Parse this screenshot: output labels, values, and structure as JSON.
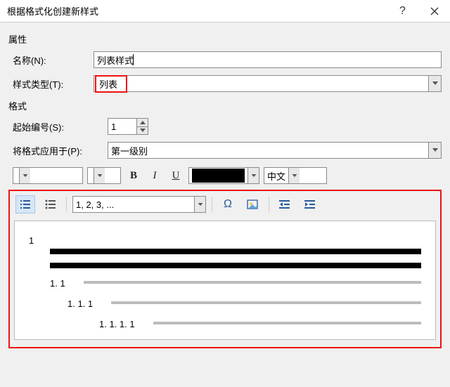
{
  "title": "根据格式化创建新样式",
  "sections": {
    "properties": "属性",
    "format": "格式"
  },
  "labels": {
    "name": "名称(N):",
    "styleType": "样式类型(T):",
    "startNumber": "起始编号(S):",
    "applyTo": "将格式应用于(P):"
  },
  "values": {
    "name": "列表样式",
    "styleType": "列表",
    "startNumber": "1",
    "applyTo": "第一级别",
    "numberFormat": "1, 2, 3, ...",
    "language": "中文"
  },
  "toolbar": {
    "bold": "B",
    "italic": "I",
    "underline": "U"
  },
  "icons": {
    "omega": "Ω"
  },
  "preview": {
    "l1": "1",
    "l2": "1. 1",
    "l3": "1. 1. 1",
    "l4": "1. 1. 1. 1"
  }
}
